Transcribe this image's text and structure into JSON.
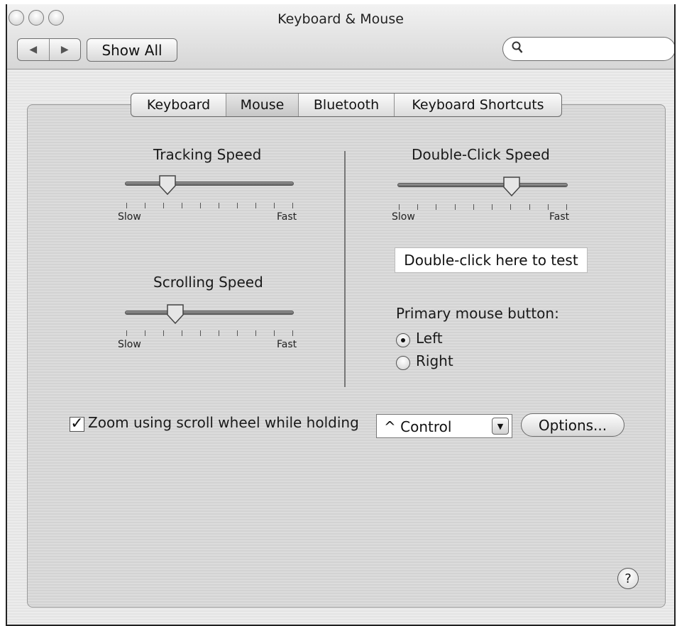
{
  "window": {
    "title": "Keyboard & Mouse"
  },
  "toolbar": {
    "back_icon": "left-arrow-icon",
    "forward_icon": "right-arrow-icon",
    "show_all_label": "Show All",
    "search_placeholder": "",
    "search_icon": "magnifier-icon"
  },
  "tabs": [
    {
      "label": "Keyboard",
      "active": false
    },
    {
      "label": "Mouse",
      "active": true
    },
    {
      "label": "Bluetooth",
      "active": false
    },
    {
      "label": "Keyboard Shortcuts",
      "active": false
    }
  ],
  "tracking": {
    "label": "Tracking Speed",
    "slow": "Slow",
    "fast": "Fast",
    "value_fraction": 0.25
  },
  "scrolling": {
    "label": "Scrolling Speed",
    "slow": "Slow",
    "fast": "Fast",
    "value_fraction": 0.3
  },
  "double_click": {
    "label": "Double-Click Speed",
    "slow": "Slow",
    "fast": "Fast",
    "value_fraction": 0.67,
    "test_label": "Double-click here to test"
  },
  "primary_button": {
    "label": "Primary mouse button:",
    "options": [
      {
        "label": "Left",
        "selected": true
      },
      {
        "label": "Right",
        "selected": false
      }
    ]
  },
  "zoom": {
    "checkbox_label": "Zoom using scroll wheel while holding",
    "checked": true,
    "modifier_value": "^ Control",
    "options_button": "Options..."
  },
  "help": {
    "label": "?"
  }
}
